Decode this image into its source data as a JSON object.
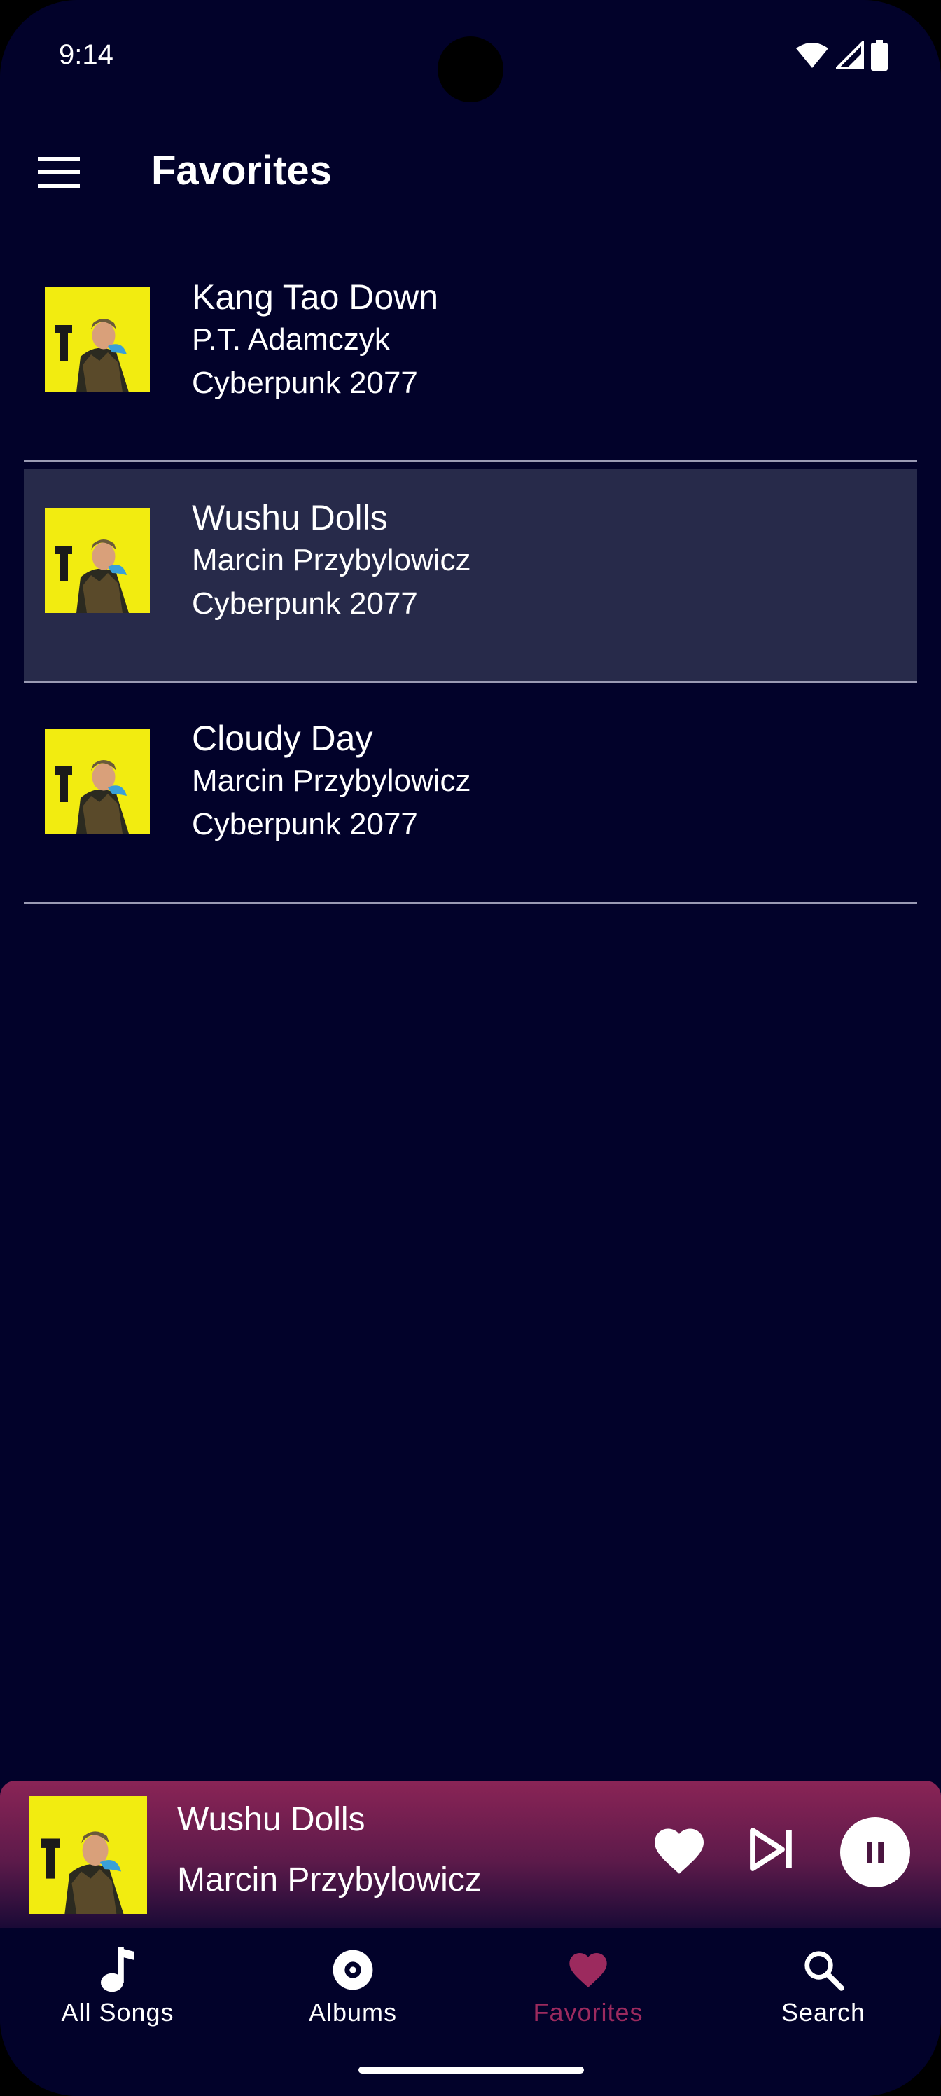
{
  "status_bar": {
    "time": "9:14",
    "icons": [
      "wifi-icon",
      "cell-signal-icon",
      "battery-icon"
    ]
  },
  "app_bar": {
    "menu_icon": "hamburger-menu-icon",
    "title": "Favorites"
  },
  "songs": [
    {
      "title": "Kang Tao Down",
      "artist": "P.T. Adamczyk",
      "album": "Cyberpunk 2077",
      "selected": false
    },
    {
      "title": "Wushu Dolls",
      "artist": "Marcin Przybylowicz",
      "album": "Cyberpunk 2077",
      "selected": true
    },
    {
      "title": "Cloudy Day",
      "artist": "Marcin Przybylowicz",
      "album": "Cyberpunk 2077",
      "selected": false
    }
  ],
  "now_playing": {
    "title": "Wushu Dolls",
    "artist": "Marcin Przybylowicz",
    "controls": [
      "heart-icon",
      "skip-next-icon",
      "pause-icon"
    ]
  },
  "bottom_nav": {
    "items": [
      {
        "label": "All Songs",
        "icon": "music-note-icon",
        "active": false
      },
      {
        "label": "Albums",
        "icon": "album-disc-icon",
        "active": false
      },
      {
        "label": "Favorites",
        "icon": "heart-icon",
        "active": true
      },
      {
        "label": "Search",
        "icon": "search-icon",
        "active": false
      }
    ]
  },
  "colors": {
    "background": "#02022a",
    "selected_row": "#272a4a",
    "divider": "#9a9ab4",
    "accent": "#9c2a5e",
    "player_gradient_top": "#8a2456",
    "player_gradient_bottom": "#1a0a36",
    "album_art_yellow": "#f2ec10"
  }
}
